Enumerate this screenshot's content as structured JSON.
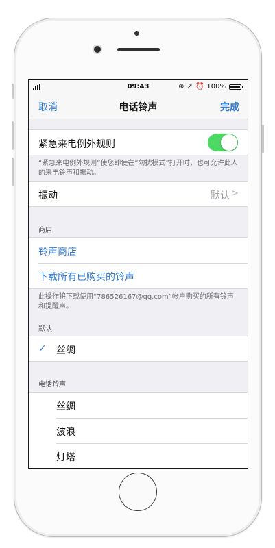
{
  "status_bar": {
    "time": "09:43",
    "battery": "100%",
    "icons": [
      "signal-icon",
      "location-icon",
      "arrow-icon",
      "alarm-icon",
      "battery-icon"
    ]
  },
  "nav": {
    "cancel": "取消",
    "title": "电话铃声",
    "done": "完成"
  },
  "emergency": {
    "label": "紧急来电例外规则",
    "toggle_on": true,
    "note": "“紧急来电例外规则”使您即使在“勿扰模式”打开时，也可允许此人的来电铃声和振动。"
  },
  "vibration": {
    "label": "振动",
    "value": "默认",
    "chevron": ">"
  },
  "store": {
    "header": "商店",
    "tone_store": "铃声商店",
    "download_all": "下载所有已购买的铃声",
    "note": "此操作将下载使用“786526167@qq.com”帐户购买的所有铃声和提醒声。"
  },
  "default_section": {
    "header": "默认",
    "selected": "丝绸",
    "check": "✓"
  },
  "ringtones": {
    "header": "电话铃声",
    "items": [
      "丝绸",
      "波浪",
      "灯塔"
    ]
  },
  "colors": {
    "accent": "#2f7bd5",
    "toggle": "#4cd964",
    "background": "#efeff4"
  }
}
